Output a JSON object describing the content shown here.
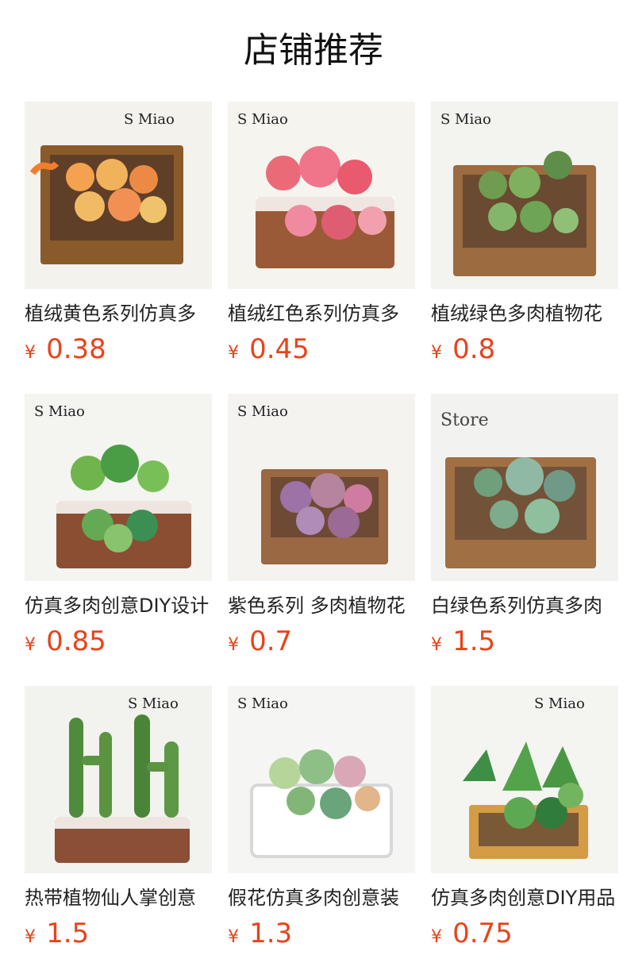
{
  "page": {
    "title": "店铺推荐"
  },
  "colors": {
    "price": "#e8431a",
    "title": "#111111",
    "name": "#222222"
  },
  "products": [
    {
      "name": "植绒黄色系列仿真多",
      "currency": "¥",
      "price": "0.38",
      "image": "yellow-succulent-box"
    },
    {
      "name": "植绒红色系列仿真多",
      "currency": "¥",
      "price": "0.45",
      "image": "red-succulent-basket"
    },
    {
      "name": "植绒绿色多肉植物花",
      "currency": "¥",
      "price": "0.8",
      "image": "green-succulent-box"
    },
    {
      "name": "仿真多肉创意DIY设计",
      "currency": "¥",
      "price": "0.85",
      "image": "green-succulent-basket"
    },
    {
      "name": "紫色系列 多肉植物花",
      "currency": "¥",
      "price": "0.7",
      "image": "purple-succulent-box"
    },
    {
      "name": "白绿色系列仿真多肉",
      "currency": "¥",
      "price": "1.5",
      "image": "white-green-succulent-box"
    },
    {
      "name": "热带植物仙人掌创意",
      "currency": "¥",
      "price": "1.5",
      "image": "cactus-basket"
    },
    {
      "name": "假花仿真多肉创意装",
      "currency": "¥",
      "price": "1.3",
      "image": "succulent-white-planter"
    },
    {
      "name": "仿真多肉创意DIY用品",
      "currency": "¥",
      "price": "0.75",
      "image": "tropical-succulent-box"
    }
  ]
}
